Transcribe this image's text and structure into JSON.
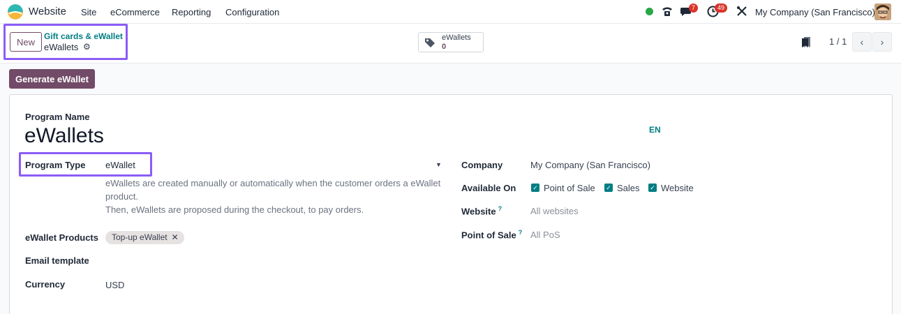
{
  "navbar": {
    "app_name": "Website",
    "menu": [
      "Site",
      "eCommerce",
      "Reporting",
      "Configuration"
    ],
    "messages_count": "7",
    "activities_count": "49",
    "company": "My Company (San Francisco)"
  },
  "control": {
    "new_label": "New",
    "breadcrumb_parent": "Gift cards & eWallet",
    "breadcrumb_current": "eWallets",
    "smart_button_label": "eWallets",
    "smart_button_value": "0",
    "pager": "1 / 1"
  },
  "actions": {
    "generate_label": "Generate eWallet"
  },
  "form": {
    "program_name_label": "Program Name",
    "program_name": "eWallets",
    "lang": "EN",
    "program_type_label": "Program Type",
    "program_type": "eWallet",
    "help_line1": "eWallets are created manually or automatically when the customer orders a eWallet",
    "help_line2": "product.",
    "help_line3": "Then, eWallets are proposed during the checkout, to pay orders.",
    "products_label": "eWallet Products",
    "product_tag": "Top-up eWallet",
    "email_template_label": "Email template",
    "currency_label": "Currency",
    "currency": "USD",
    "company_label": "Company",
    "company": "My Company (San Francisco)",
    "available_on_label": "Available On",
    "available_on": [
      "Point of Sale",
      "Sales",
      "Website"
    ],
    "website_label": "Website",
    "website_placeholder": "All websites",
    "pos_label": "Point of Sale",
    "pos_placeholder": "All PoS",
    "help_marker": "?"
  },
  "colors": {
    "brand": "#714b67",
    "accent": "#017e84",
    "highlight": "#8b5cf6",
    "badge": "#d9342b"
  }
}
